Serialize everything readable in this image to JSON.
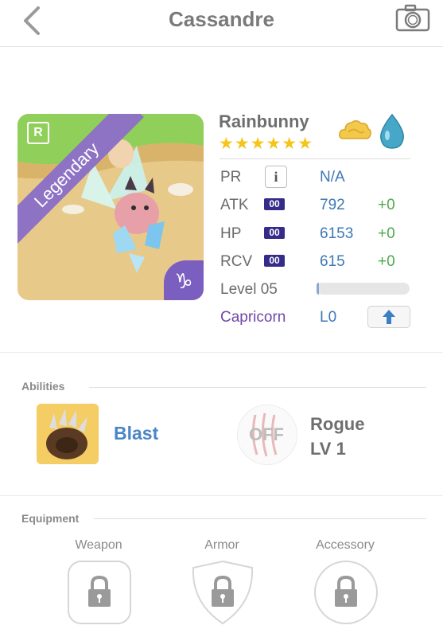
{
  "header": {
    "title": "Cassandre",
    "back_icon": "chevron-left-icon",
    "camera_icon": "camera-icon"
  },
  "pet": {
    "rarity_letter": "R",
    "rarity_label": "Legendary",
    "zodiac_glyph": "♑",
    "name": "Rainbunny",
    "stars": "★★★★★★",
    "star_count": 6,
    "elements": [
      "cloud-icon",
      "water-drop-icon"
    ]
  },
  "stats": {
    "pr": {
      "label": "PR",
      "info_glyph": "i",
      "value": "N/A"
    },
    "atk": {
      "label": "ATK",
      "badge": "00",
      "value": "792",
      "bonus": "+0"
    },
    "hp": {
      "label": "HP",
      "badge": "00",
      "value": "6153",
      "bonus": "+0"
    },
    "rcv": {
      "label": "RCV",
      "badge": "00",
      "value": "615",
      "bonus": "+0"
    },
    "level": {
      "label": "Level 05",
      "progress": 0.02
    },
    "sign": {
      "label": "Capricorn",
      "value": "L0",
      "upgrade_icon": "arrow-up-icon"
    }
  },
  "abilities": {
    "section_title": "Abilities",
    "active": {
      "name": "Blast",
      "icon": "bear-paw-icon"
    },
    "class": {
      "state": "OFF",
      "name": "Rogue",
      "level": "LV 1",
      "icon": "claw-marks-icon"
    }
  },
  "equipment": {
    "section_title": "Equipment",
    "slots": [
      {
        "label": "Weapon",
        "icon": "lock-icon"
      },
      {
        "label": "Armor",
        "icon": "lock-icon"
      },
      {
        "label": "Accessory",
        "icon": "lock-icon"
      }
    ]
  },
  "colors": {
    "accent_blue": "#3d78b5",
    "bonus_green": "#4caa4c",
    "legendary_purple": "#8e72c4",
    "star_gold": "#f6c51a"
  }
}
